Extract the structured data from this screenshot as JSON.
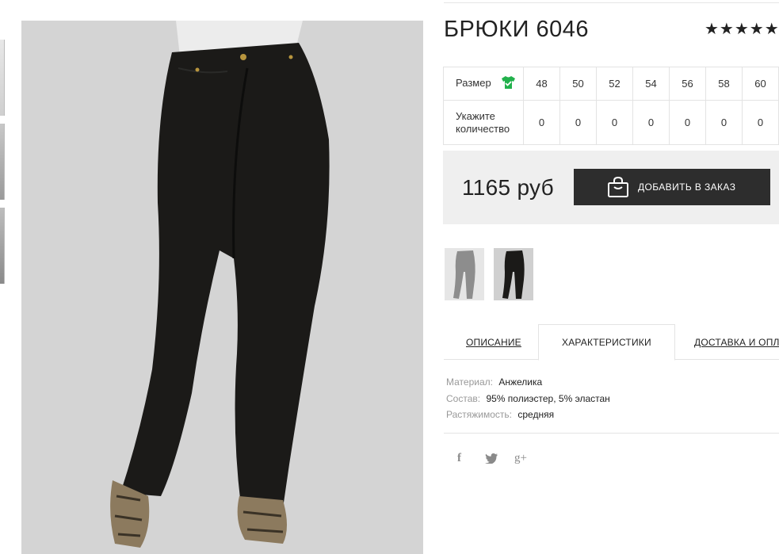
{
  "product": {
    "title": "БРЮКИ 6046",
    "rating_stars": "★★★★★"
  },
  "size_table": {
    "size_label": "Размер",
    "qty_label": "Укажите количество",
    "sizes": [
      "48",
      "50",
      "52",
      "54",
      "56",
      "58",
      "60"
    ],
    "quantities": [
      "0",
      "0",
      "0",
      "0",
      "0",
      "0",
      "0"
    ]
  },
  "price": {
    "value": "1165 руб",
    "add_button_label": "ДОБАВИТЬ В ЗАКАЗ"
  },
  "tabs": {
    "description": "ОПИСАНИЕ",
    "characteristics": "ХАРАКТЕРИСТИКИ",
    "delivery": "ДОСТАВКА И ОПЛАТА"
  },
  "characteristics": {
    "material_label": "Материал:",
    "material_value": "Анжелика",
    "composition_label": "Состав:",
    "composition_value": "95% полиэстер, 5% эластан",
    "stretch_label": "Растяжимость:",
    "stretch_value": "средняя"
  },
  "social": {
    "facebook": "f",
    "twitter_icon": "twitter-icon",
    "googleplus": "g+"
  },
  "colors": {
    "button_bg": "#2d2d2d",
    "price_bg": "#efefef",
    "shirt_icon": "#22b14c"
  }
}
